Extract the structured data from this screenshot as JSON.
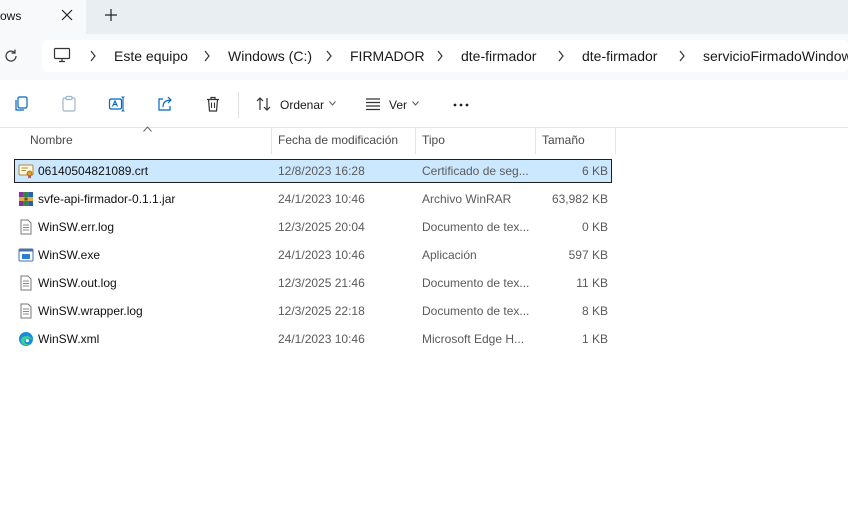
{
  "tab": {
    "title": "ows"
  },
  "breadcrumb": [
    "Este equipo",
    "Windows (C:)",
    "FIRMADOR",
    "dte-firmador",
    "dte-firmador",
    "servicioFirmadoWindow"
  ],
  "toolbar": {
    "sort_label": "Ordenar",
    "view_label": "Ver"
  },
  "columns": {
    "name": "Nombre",
    "date": "Fecha de modificación",
    "type": "Tipo",
    "size": "Tamaño"
  },
  "files": [
    {
      "name": "06140504821089.crt",
      "date": "12/8/2023 16:28",
      "type": "Certificado de seg...",
      "size": "6 KB",
      "icon": "certificate-icon",
      "selected": true
    },
    {
      "name": "svfe-api-firmador-0.1.1.jar",
      "date": "24/1/2023 10:46",
      "type": "Archivo WinRAR",
      "size": "63,982 KB",
      "icon": "winrar-icon",
      "selected": false
    },
    {
      "name": "WinSW.err.log",
      "date": "12/3/2025 20:04",
      "type": "Documento de tex...",
      "size": "0 KB",
      "icon": "text-file-icon",
      "selected": false
    },
    {
      "name": "WinSW.exe",
      "date": "24/1/2023 10:46",
      "type": "Aplicación",
      "size": "597 KB",
      "icon": "application-icon",
      "selected": false
    },
    {
      "name": "WinSW.out.log",
      "date": "12/3/2025 21:46",
      "type": "Documento de tex...",
      "size": "11 KB",
      "icon": "text-file-icon",
      "selected": false
    },
    {
      "name": "WinSW.wrapper.log",
      "date": "12/3/2025 22:18",
      "type": "Documento de tex...",
      "size": "8 KB",
      "icon": "text-file-icon",
      "selected": false
    },
    {
      "name": "WinSW.xml",
      "date": "24/1/2023 10:46",
      "type": "Microsoft Edge H...",
      "size": "1 KB",
      "icon": "edge-icon",
      "selected": false
    }
  ],
  "colors": {
    "selection": "#cce8ff",
    "accent": "#0067c0"
  }
}
